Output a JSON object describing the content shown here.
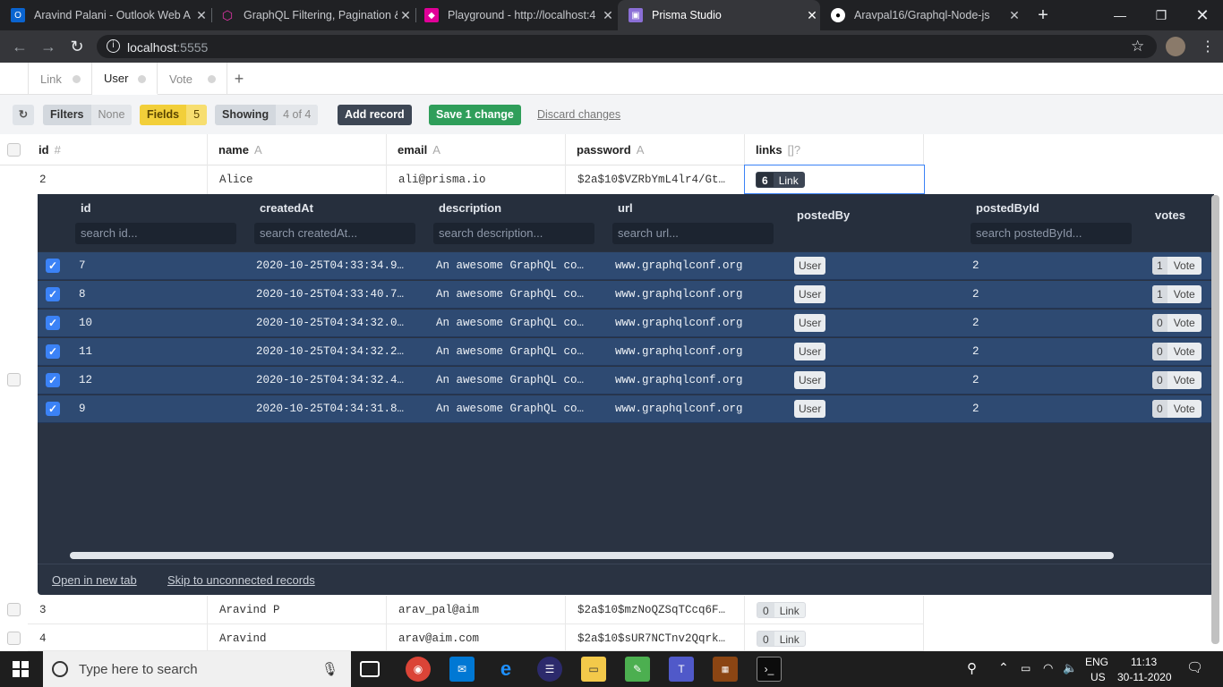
{
  "browser": {
    "tabs": [
      {
        "title": "Aravind Palani - Outlook Web A",
        "icon": "outlook-icon"
      },
      {
        "title": "GraphQL Filtering, Pagination &",
        "icon": "graphql-icon"
      },
      {
        "title": "Playground - http://localhost:4",
        "icon": "graphql-playground-icon"
      },
      {
        "title": "Prisma Studio",
        "icon": "prisma-icon"
      },
      {
        "title": "Aravpal16/Graphql-Node-js",
        "icon": "github-icon"
      }
    ],
    "url_host": "localhost",
    "url_port": ":5555"
  },
  "model_tabs": [
    {
      "label": "Link"
    },
    {
      "label": "User"
    },
    {
      "label": "Vote"
    }
  ],
  "toolbar": {
    "filters_label": "Filters",
    "filters_value": "None",
    "fields_label": "Fields",
    "fields_value": "5",
    "showing_label": "Showing",
    "showing_value": "4 of 4",
    "add_record": "Add record",
    "save_change": "Save 1 change",
    "discard": "Discard changes"
  },
  "grid": {
    "columns": [
      {
        "name": "id",
        "type": "#"
      },
      {
        "name": "name",
        "type": "A"
      },
      {
        "name": "email",
        "type": "A"
      },
      {
        "name": "password",
        "type": "A"
      },
      {
        "name": "links",
        "type": "[]?"
      }
    ],
    "rows": [
      {
        "id": "2",
        "name": "Alice",
        "email": "ali@prisma.io",
        "password": "$2a$10$VZRbYmL4lr4/Gt…",
        "links_count": "6",
        "links_label": "Link"
      },
      {
        "id": "3",
        "name": "Aravind P",
        "email": "arav_pal@aim",
        "password": "$2a$10$mzNoQZSqTCcq6F…",
        "links_count": "0",
        "links_label": "Link"
      },
      {
        "id": "4",
        "name": "Aravind",
        "email": "arav@aim.com",
        "password": "$2a$10$sUR7NCTnv2Qqrk…",
        "links_count": "0",
        "links_label": "Link"
      }
    ]
  },
  "panel": {
    "columns": [
      {
        "name": "id",
        "placeholder": "search id..."
      },
      {
        "name": "createdAt",
        "placeholder": "search createdAt..."
      },
      {
        "name": "description",
        "placeholder": "search description..."
      },
      {
        "name": "url",
        "placeholder": "search url..."
      },
      {
        "name": "postedBy",
        "placeholder": ""
      },
      {
        "name": "postedById",
        "placeholder": "search postedById..."
      },
      {
        "name": "votes",
        "placeholder": ""
      }
    ],
    "rows": [
      {
        "id": "7",
        "createdAt": "2020-10-25T04:33:34.9…",
        "description": "An awesome GraphQL co…",
        "url": "www.graphqlconf.org",
        "postedBy": "User",
        "postedById": "2",
        "votes_count": "1",
        "votes_label": "Vote"
      },
      {
        "id": "8",
        "createdAt": "2020-10-25T04:33:40.7…",
        "description": "An awesome GraphQL co…",
        "url": "www.graphqlconf.org",
        "postedBy": "User",
        "postedById": "2",
        "votes_count": "1",
        "votes_label": "Vote"
      },
      {
        "id": "10",
        "createdAt": "2020-10-25T04:34:32.0…",
        "description": "An awesome GraphQL co…",
        "url": "www.graphqlconf.org",
        "postedBy": "User",
        "postedById": "2",
        "votes_count": "0",
        "votes_label": "Vote"
      },
      {
        "id": "11",
        "createdAt": "2020-10-25T04:34:32.2…",
        "description": "An awesome GraphQL co…",
        "url": "www.graphqlconf.org",
        "postedBy": "User",
        "postedById": "2",
        "votes_count": "0",
        "votes_label": "Vote"
      },
      {
        "id": "12",
        "createdAt": "2020-10-25T04:34:32.4…",
        "description": "An awesome GraphQL co…",
        "url": "www.graphqlconf.org",
        "postedBy": "User",
        "postedById": "2",
        "votes_count": "0",
        "votes_label": "Vote"
      },
      {
        "id": "9",
        "createdAt": "2020-10-25T04:34:31.8…",
        "description": "An awesome GraphQL co…",
        "url": "www.graphqlconf.org",
        "postedBy": "User",
        "postedById": "2",
        "votes_count": "0",
        "votes_label": "Vote"
      }
    ],
    "open_new_tab": "Open in new tab",
    "skip_unconnected": "Skip to unconnected records"
  },
  "taskbar": {
    "search_placeholder": "Type here to search",
    "lang": "ENG",
    "region": "US",
    "time": "11:13",
    "date": "30-11-2020"
  },
  "colors": {
    "selected_row": "#2e4a72",
    "panel_bg": "#2a3342",
    "save_green": "#2f9e5a",
    "fields_yellow": "#f6d64a"
  }
}
